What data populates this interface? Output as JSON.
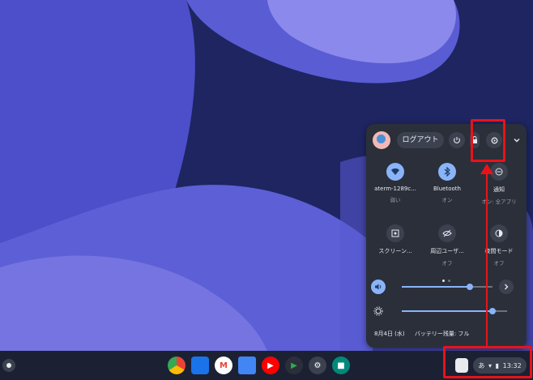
{
  "colors": {
    "accent": "#8ab4f8",
    "panel_bg": "#2b2f3a",
    "highlight": "#e8131a",
    "wallpaper_dark": "#1e2561"
  },
  "quick_settings": {
    "logout_label": "ログアウト",
    "icons": {
      "power": "power-icon",
      "lock": "lock-icon",
      "settings": "gear-icon",
      "collapse": "chevron-down-icon"
    },
    "tiles": [
      {
        "label": "aterm-1289c...",
        "sub": "弱い",
        "icon": "wifi-icon",
        "active": true
      },
      {
        "label": "Bluetooth",
        "sub": "オン",
        "icon": "bluetooth-icon",
        "active": true
      },
      {
        "label": "通知",
        "sub": "オン: 全アプリ",
        "icon": "notifications-icon",
        "active": false
      },
      {
        "label": "スクリーン...",
        "sub": "",
        "icon": "screen-capture-icon",
        "active": false
      },
      {
        "label": "周辺ユーザ...",
        "sub": "オフ",
        "icon": "nearby-share-icon",
        "active": false
      },
      {
        "label": "夜間モード",
        "sub": "オフ",
        "icon": "night-light-icon",
        "active": false
      }
    ],
    "volume_level": 0.75,
    "brightness_level": 0.86,
    "footer": {
      "date": "8月4日 (水)",
      "battery": "バッテリー残量: フル"
    }
  },
  "shelf": {
    "apps": [
      {
        "name": "Chrome",
        "icon": "chrome-icon"
      },
      {
        "name": "Files",
        "icon": "files-icon"
      },
      {
        "name": "Gmail",
        "icon": "gmail-icon"
      },
      {
        "name": "Docs",
        "icon": "docs-icon"
      },
      {
        "name": "YouTube",
        "icon": "youtube-icon"
      },
      {
        "name": "Play Store",
        "icon": "play-store-icon"
      },
      {
        "name": "Settings",
        "icon": "settings-app-icon"
      },
      {
        "name": "Meet",
        "icon": "meet-icon"
      }
    ],
    "status": {
      "ime": "あ",
      "time": "13:32"
    }
  }
}
